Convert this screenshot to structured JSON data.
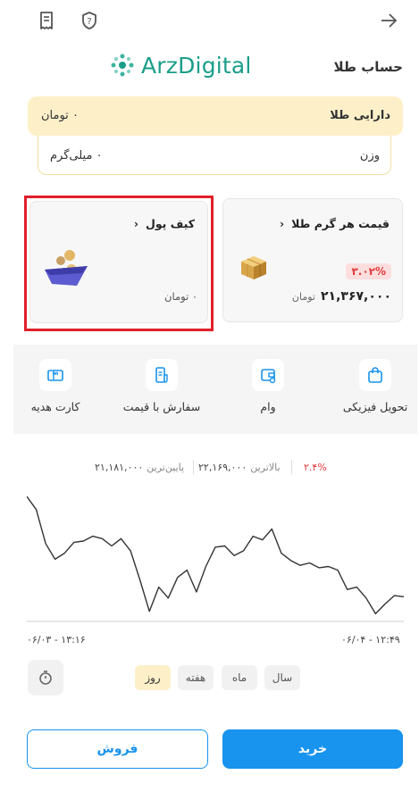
{
  "header": {
    "title": "حساب طلا",
    "logo_text": "ArzDigital"
  },
  "gold_account": {
    "assets_label": "دارایی طلا",
    "assets_value": "۰ تومان",
    "weight_label": "وزن",
    "weight_value": "۰ میلی‌گرم"
  },
  "price_card": {
    "title": "قیمت هر گرم طلا",
    "change": "۳.۰۲%",
    "price": "۲۱,۳۶۷,۰۰۰",
    "unit": "تومان"
  },
  "wallet_card": {
    "title": "کیف پول",
    "value": "۰ تومان"
  },
  "services": [
    {
      "label": "تحویل فیزیکی",
      "icon": "bag-icon"
    },
    {
      "label": "وام",
      "icon": "wallet-icon"
    },
    {
      "label": "سفارش با قیمت",
      "icon": "receipt-icon"
    },
    {
      "label": "کارت هدیه",
      "icon": "gift-card-icon"
    }
  ],
  "stats": {
    "change": "۲.۴%",
    "high_label": "بالاترین",
    "high_value": "۲۲,۱۶۹,۰۰۰",
    "low_label": "پایین‌ترین",
    "low_value": "۲۱,۱۸۱,۰۰۰"
  },
  "chart_data": {
    "type": "line",
    "x_start_label": "۰۶/۰۳ - ۱۳:۱۶",
    "x_end_label": "۰۶/۰۴ - ۱۲:۴۹",
    "ylim": [
      21181000,
      22169000
    ],
    "values": [
      22169000,
      22060000,
      21780000,
      21650000,
      21700000,
      21790000,
      21800000,
      21840000,
      21820000,
      21760000,
      21820000,
      21720000,
      21480000,
      21220000,
      21420000,
      21330000,
      21500000,
      21560000,
      21380000,
      21590000,
      21750000,
      21760000,
      21680000,
      21720000,
      21840000,
      21810000,
      21900000,
      21700000,
      21640000,
      21600000,
      21620000,
      21580000,
      21590000,
      21560000,
      21400000,
      21420000,
      21330000,
      21200000,
      21280000,
      21350000,
      21340000
    ],
    "grid": false
  },
  "periods": [
    {
      "label": "روز",
      "active": true
    },
    {
      "label": "هفته",
      "active": false
    },
    {
      "label": "ماه",
      "active": false
    },
    {
      "label": "سال",
      "active": false
    }
  ],
  "actions": {
    "buy": "خرید",
    "sell": "فروش"
  },
  "colors": {
    "accent_blue": "#1893ee",
    "gold_bg": "#fdf0c9",
    "badge_red": "#e13b3b",
    "logo_teal": "#1a9e8a",
    "highlight_frame": "#e0202a"
  }
}
